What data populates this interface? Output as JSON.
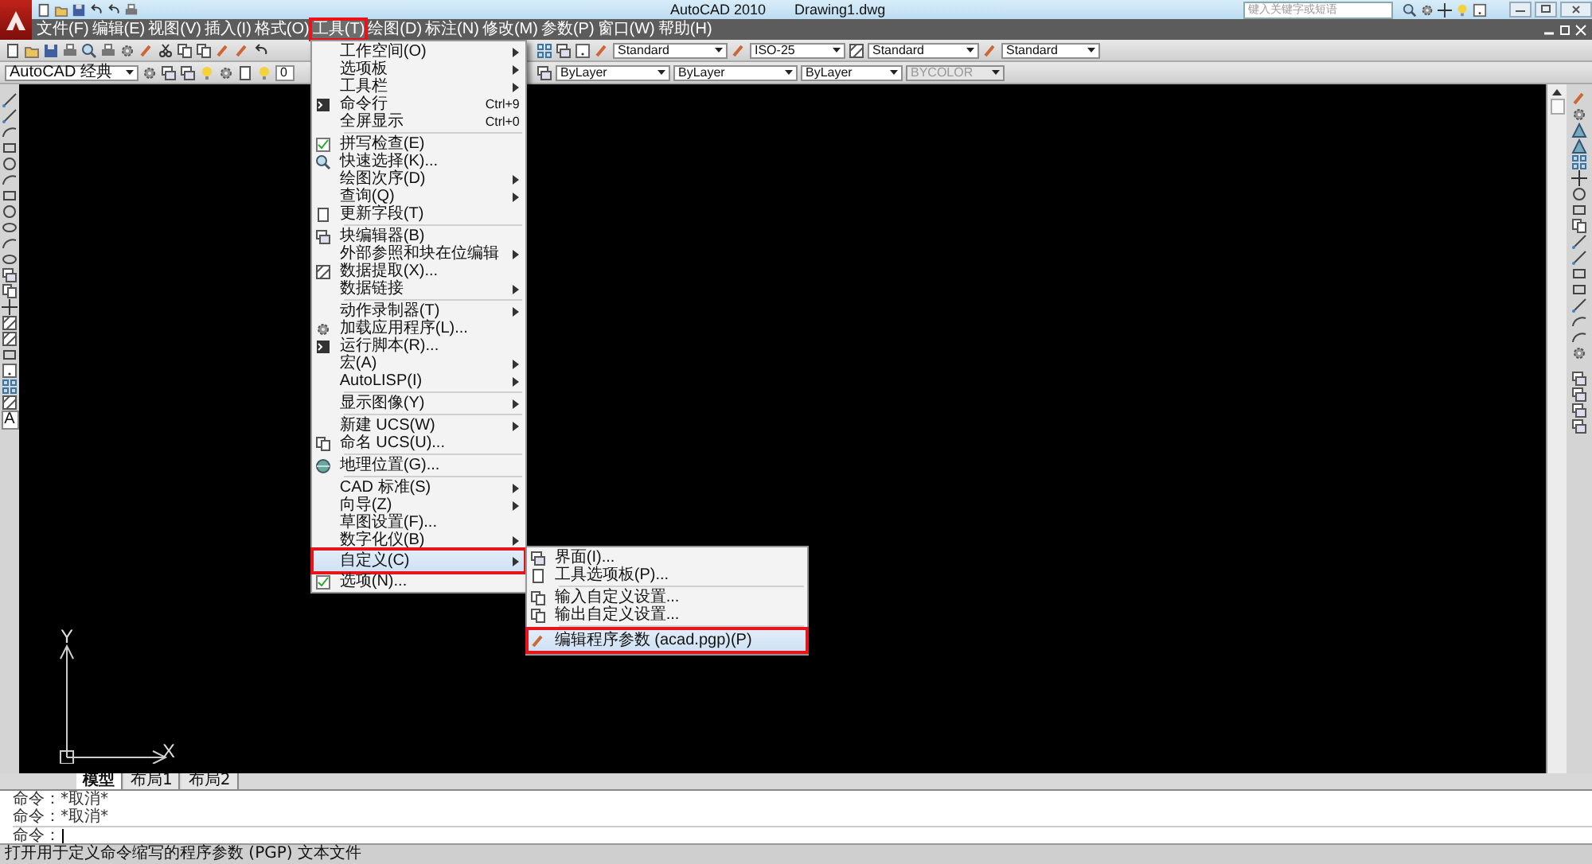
{
  "title_bar": {
    "app_title": "AutoCAD 2010",
    "document": "Drawing1.dwg",
    "search": {
      "placeholder": "键入关键字或短语"
    }
  },
  "menu_bar": [
    {
      "label": "文件(F)",
      "selected": false,
      "marked": false
    },
    {
      "label": "编辑(E)",
      "selected": false,
      "marked": false
    },
    {
      "label": "视图(V)",
      "selected": false,
      "marked": false
    },
    {
      "label": "插入(I)",
      "selected": false,
      "marked": false
    },
    {
      "label": "格式(O)",
      "selected": false,
      "marked": false
    },
    {
      "label": "工具(T)",
      "selected": true,
      "marked": true
    },
    {
      "label": "绘图(D)",
      "selected": false,
      "marked": false
    },
    {
      "label": "标注(N)",
      "selected": false,
      "marked": false
    },
    {
      "label": "修改(M)",
      "selected": false,
      "marked": false
    },
    {
      "label": "参数(P)",
      "selected": false,
      "marked": false
    },
    {
      "label": "窗口(W)",
      "selected": false,
      "marked": false
    },
    {
      "label": "帮助(H)",
      "selected": false,
      "marked": false
    }
  ],
  "tools_menu": [
    {
      "kind": "item",
      "label": "工作空间(O)",
      "submenu": true,
      "icon": false,
      "selected": false,
      "marked": false
    },
    {
      "kind": "item",
      "label": "选项板",
      "submenu": true,
      "icon": false,
      "selected": false,
      "marked": false
    },
    {
      "kind": "item",
      "label": "工具栏",
      "submenu": true,
      "icon": false,
      "selected": false,
      "marked": false
    },
    {
      "kind": "item",
      "label": "命令行",
      "shortcut": "Ctrl+9",
      "submenu": false,
      "icon": true,
      "selected": false,
      "marked": false
    },
    {
      "kind": "item",
      "label": "全屏显示",
      "shortcut": "Ctrl+0",
      "submenu": false,
      "icon": false,
      "selected": false,
      "marked": false
    },
    {
      "kind": "separator"
    },
    {
      "kind": "item",
      "label": "拼写检查(E)",
      "submenu": false,
      "icon": true,
      "selected": false,
      "marked": false
    },
    {
      "kind": "item",
      "label": "快速选择(K)...",
      "submenu": false,
      "icon": true,
      "selected": false,
      "marked": false
    },
    {
      "kind": "item",
      "label": "绘图次序(D)",
      "submenu": true,
      "icon": false,
      "selected": false,
      "marked": false
    },
    {
      "kind": "item",
      "label": "查询(Q)",
      "submenu": true,
      "icon": false,
      "selected": false,
      "marked": false
    },
    {
      "kind": "item",
      "label": "更新字段(T)",
      "submenu": false,
      "icon": true,
      "selected": false,
      "marked": false
    },
    {
      "kind": "separator"
    },
    {
      "kind": "item",
      "label": "块编辑器(B)",
      "submenu": false,
      "icon": true,
      "selected": false,
      "marked": false
    },
    {
      "kind": "item",
      "label": "外部参照和块在位编辑",
      "submenu": true,
      "icon": false,
      "selected": false,
      "marked": false
    },
    {
      "kind": "item",
      "label": "数据提取(X)...",
      "submenu": false,
      "icon": true,
      "selected": false,
      "marked": false
    },
    {
      "kind": "item",
      "label": "数据链接",
      "submenu": true,
      "icon": false,
      "selected": false,
      "marked": false
    },
    {
      "kind": "separator"
    },
    {
      "kind": "item",
      "label": "动作录制器(T)",
      "submenu": true,
      "icon": false,
      "selected": false,
      "marked": false
    },
    {
      "kind": "item",
      "label": "加载应用程序(L)...",
      "submenu": false,
      "icon": true,
      "selected": false,
      "marked": false
    },
    {
      "kind": "item",
      "label": "运行脚本(R)...",
      "submenu": false,
      "icon": true,
      "selected": false,
      "marked": false
    },
    {
      "kind": "item",
      "label": "宏(A)",
      "submenu": true,
      "icon": false,
      "selected": false,
      "marked": false
    },
    {
      "kind": "item",
      "label": "AutoLISP(I)",
      "submenu": true,
      "icon": false,
      "selected": false,
      "marked": false
    },
    {
      "kind": "separator"
    },
    {
      "kind": "item",
      "label": "显示图像(Y)",
      "submenu": true,
      "icon": false,
      "selected": false,
      "marked": false
    },
    {
      "kind": "separator"
    },
    {
      "kind": "item",
      "label": "新建 UCS(W)",
      "submenu": true,
      "icon": false,
      "selected": false,
      "marked": false
    },
    {
      "kind": "item",
      "label": "命名 UCS(U)...",
      "submenu": false,
      "icon": true,
      "selected": false,
      "marked": false
    },
    {
      "kind": "separator"
    },
    {
      "kind": "item",
      "label": "地理位置(G)...",
      "submenu": false,
      "icon": true,
      "selected": false,
      "marked": false
    },
    {
      "kind": "separator"
    },
    {
      "kind": "item",
      "label": "CAD 标准(S)",
      "submenu": true,
      "icon": false,
      "selected": false,
      "marked": false
    },
    {
      "kind": "item",
      "label": "向导(Z)",
      "submenu": true,
      "icon": false,
      "selected": false,
      "marked": false
    },
    {
      "kind": "item",
      "label": "草图设置(F)...",
      "submenu": false,
      "icon": false,
      "selected": false,
      "marked": false
    },
    {
      "kind": "item",
      "label": "数字化仪(B)",
      "submenu": true,
      "icon": false,
      "selected": false,
      "marked": false
    },
    {
      "kind": "item",
      "label": "自定义(C)",
      "submenu": true,
      "icon": false,
      "selected": true,
      "marked": true
    },
    {
      "kind": "item",
      "label": "选项(N)...",
      "submenu": false,
      "icon": true,
      "selected": false,
      "marked": false
    }
  ],
  "customize_submenu": [
    {
      "kind": "item",
      "label": "界面(I)...",
      "icon": true,
      "selected": false,
      "marked": false
    },
    {
      "kind": "item",
      "label": "工具选项板(P)...",
      "icon": true,
      "selected": false,
      "marked": false
    },
    {
      "kind": "separator"
    },
    {
      "kind": "item",
      "label": "输入自定义设置...",
      "icon": true,
      "selected": false,
      "marked": false
    },
    {
      "kind": "item",
      "label": "输出自定义设置...",
      "icon": true,
      "selected": false,
      "marked": false
    },
    {
      "kind": "separator"
    },
    {
      "kind": "item",
      "label": "编辑程序参数 (acad.pgp)(P)",
      "icon": true,
      "selected": true,
      "marked": true
    }
  ],
  "toolbar_1": {
    "combos": [
      {
        "value": "Standard",
        "disabled": false
      },
      {
        "value": "ISO-25",
        "disabled": false
      },
      {
        "value": "Standard",
        "disabled": false
      },
      {
        "value": "Standard",
        "disabled": false
      }
    ]
  },
  "toolbar_2": {
    "workspace": "AutoCAD 经典",
    "layer": "0",
    "combos": [
      {
        "value": "ByLayer",
        "disabled": false
      },
      {
        "value": "ByLayer",
        "disabled": false
      },
      {
        "value": "ByLayer",
        "disabled": false
      },
      {
        "value": "BYCOLOR",
        "disabled": true
      }
    ]
  },
  "draw_toolbar": {
    "text_tool": "A"
  },
  "ucs": {
    "y_label": "Y",
    "x_label": "X"
  },
  "layout_tabs": [
    {
      "label": "模型",
      "selected": true
    },
    {
      "label": "布局1",
      "selected": false
    },
    {
      "label": "布局2",
      "selected": false
    }
  ],
  "command_line": {
    "history": [
      "命令：*取消*",
      "命令：*取消*"
    ],
    "prompt": "命令："
  },
  "status_bar": {
    "text": "打开用于定义命令缩写的程序参数 (PGP) 文本文件"
  }
}
